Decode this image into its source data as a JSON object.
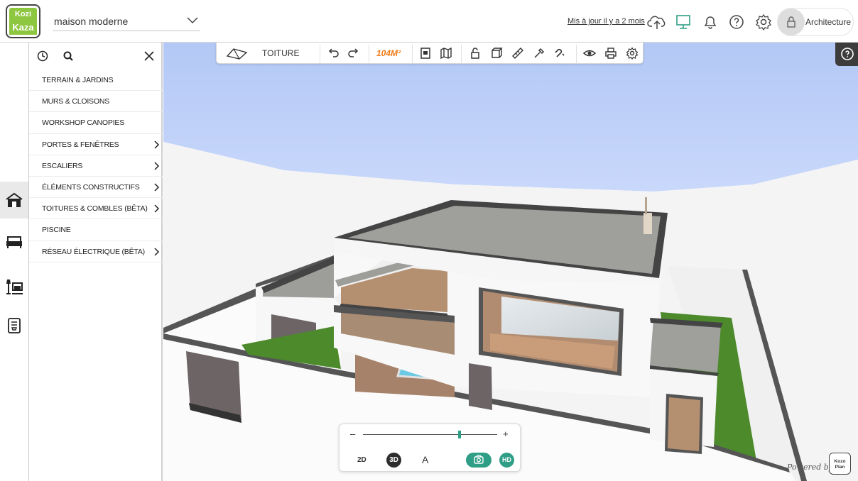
{
  "logo": {
    "line1": "Kozi",
    "line2": "Kaza"
  },
  "project": {
    "name": "maison moderne"
  },
  "header": {
    "updated_label": "Mis à jour il y a 2 mois",
    "account_label": "Architecture"
  },
  "panel": {
    "menu": [
      {
        "label": "TERRAIN & JARDINS",
        "has_submenu": false
      },
      {
        "label": "MURS & CLOISONS",
        "has_submenu": false
      },
      {
        "label": "WORKSHOP CANOPIES",
        "has_submenu": false
      },
      {
        "label": "PORTES & FENÊTRES",
        "has_submenu": true
      },
      {
        "label": "ESCALIERS",
        "has_submenu": true
      },
      {
        "label": "ÉLÉMENTS CONSTRUCTIFS",
        "has_submenu": true
      },
      {
        "label": "TOITURES & COMBLES (BÊTA)",
        "has_submenu": true
      },
      {
        "label": "PISCINE",
        "has_submenu": false
      },
      {
        "label": "RÉSEAU ÉLECTRIQUE (BÊTA)",
        "has_submenu": true
      }
    ]
  },
  "toolbar": {
    "mode_label": "TOITURE",
    "area_label": "104M²"
  },
  "viewctrl": {
    "minus": "–",
    "plus": "+",
    "zoom_level": 0.72,
    "label_2d": "2D",
    "label_3d": "3D",
    "label_text": "A",
    "label_hd": "HD"
  },
  "footer": {
    "powered_by": "Powered by",
    "brand_line1": "Kozo",
    "brand_line2": "Plan"
  },
  "colors": {
    "accent": "#2f9e86",
    "logo_green": "#8dc63f",
    "area_orange": "#f07d1b",
    "sky": "#b9cdf7"
  }
}
